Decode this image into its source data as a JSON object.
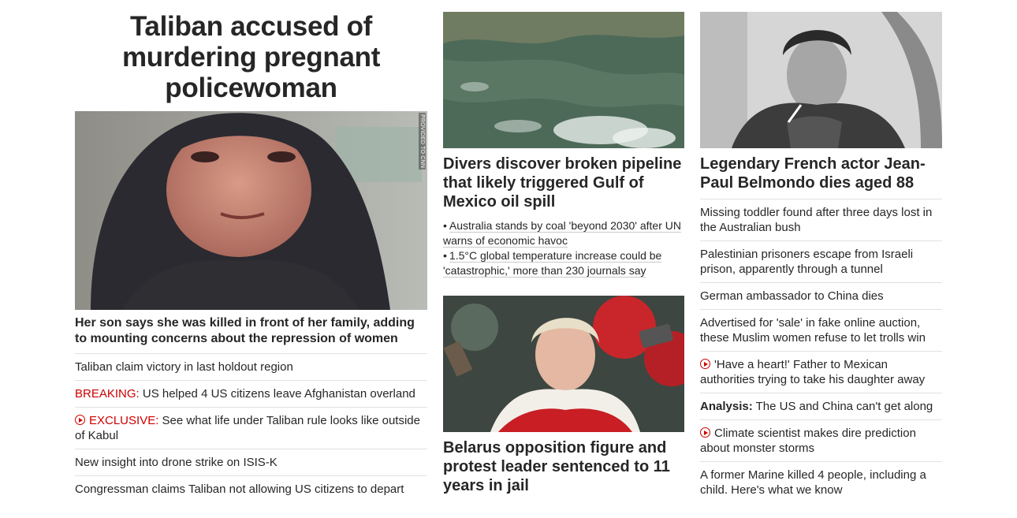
{
  "column1": {
    "title": "Taliban accused of murdering pregnant policewoman",
    "image_credit": "PROVIDED TO CNN",
    "lead": "Her son says she was killed in front of her family, adding to mounting concerns about the repression of women",
    "items": [
      {
        "prefix": "",
        "text": "Taliban claim victory in last holdout region"
      },
      {
        "prefix": "BREAKING:",
        "text": " US helped 4 US citizens leave Afghanistan overland"
      },
      {
        "prefix": "EXCLUSIVE:",
        "text": " See what life under Taliban rule looks like outside of Kabul"
      },
      {
        "prefix": "",
        "text": "New insight into drone strike on ISIS-K"
      },
      {
        "prefix": "",
        "text": "Congressman claims Taliban not allowing US citizens to depart"
      }
    ]
  },
  "column2": {
    "story1": {
      "headline": "Divers discover broken pipeline that likely triggered Gulf of Mexico oil spill",
      "links": [
        "Australia stands by coal 'beyond 2030' after UN warns of economic havoc",
        "1.5°C global temperature increase could be 'catastrophic,' more than 230 journals say"
      ]
    },
    "story2": {
      "headline": "Belarus opposition figure and protest leader sentenced to 11 years in jail"
    }
  },
  "column3": {
    "headline": "Legendary French actor Jean-Paul Belmondo dies aged 88",
    "items": [
      {
        "prefix": "",
        "text": "Missing toddler found after three days lost in the Australian bush"
      },
      {
        "prefix": "",
        "text": "Palestinian prisoners escape from Israeli prison, apparently through a tunnel"
      },
      {
        "prefix": "",
        "text": "German ambassador to China dies"
      },
      {
        "prefix": "",
        "text": "Advertised for 'sale' in fake online auction, these Muslim women refuse to let trolls win"
      },
      {
        "prefix": "",
        "text": "'Have a heart!' Father to Mexican authorities trying to take his daughter away"
      },
      {
        "prefix": "Analysis:",
        "text": " The US and China can't get along"
      },
      {
        "prefix": "",
        "text": "Climate scientist makes dire prediction about monster storms"
      },
      {
        "prefix": "",
        "text": "A former Marine killed 4 people, including a child. Here's what we know"
      }
    ]
  },
  "colors": {
    "accent_red": "#cc0000",
    "text": "#262626",
    "divider": "#e1e1e1"
  }
}
